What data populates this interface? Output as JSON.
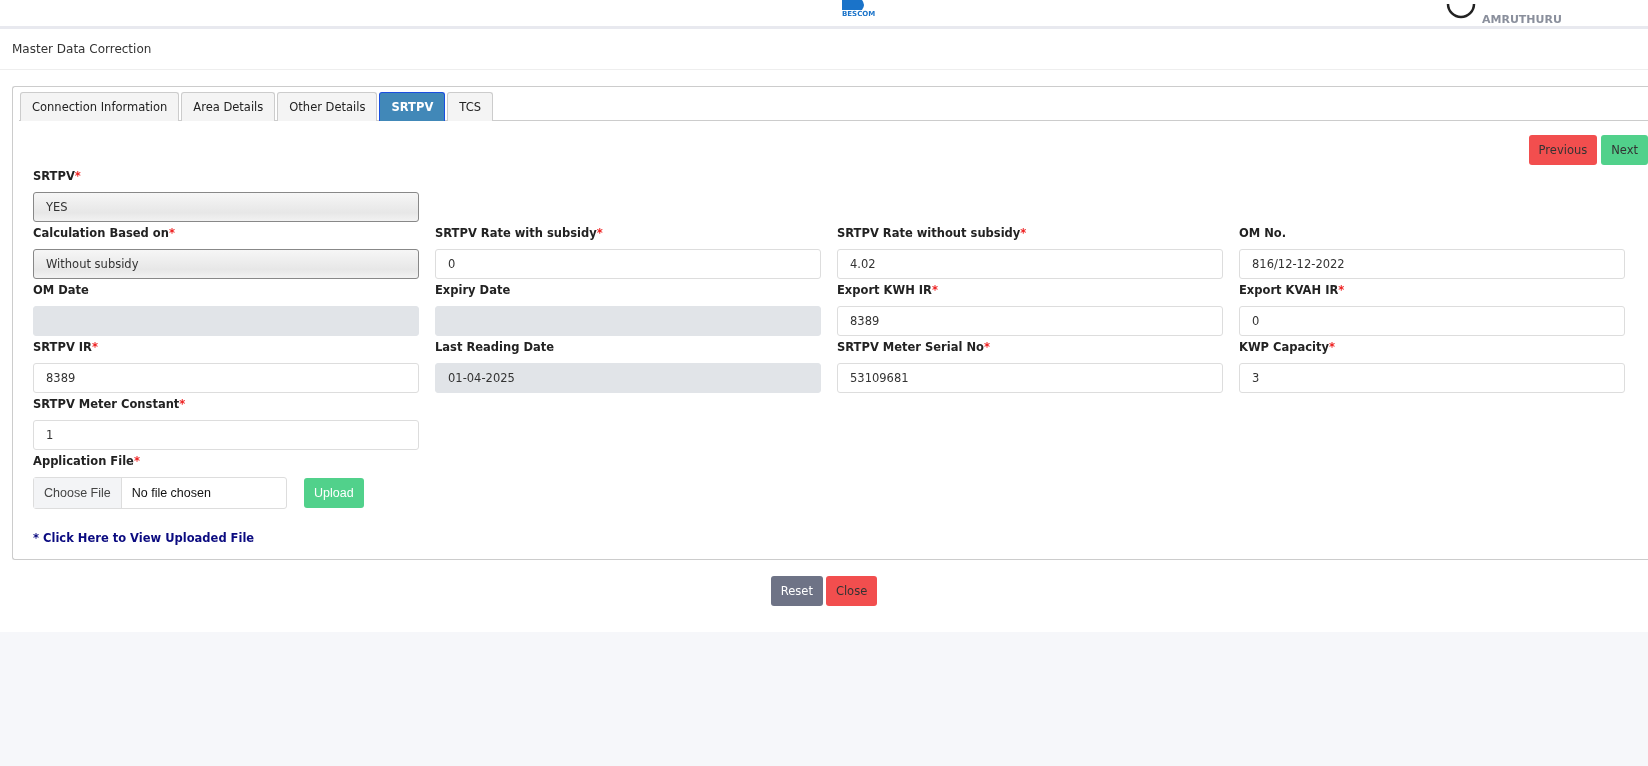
{
  "header": {
    "logo_text": "BESCOM",
    "user_name": "AMRUTHURU"
  },
  "page_title": "Master Data Correction",
  "tabs": [
    {
      "label": "Connection Information",
      "selected": false
    },
    {
      "label": "Area Details",
      "selected": false
    },
    {
      "label": "Other Details",
      "selected": false
    },
    {
      "label": "SRTPV",
      "selected": true
    },
    {
      "label": "TCS",
      "selected": false
    }
  ],
  "nav_buttons": [
    {
      "label": "Previous",
      "kind": "danger"
    },
    {
      "label": "Next",
      "kind": "success"
    }
  ],
  "rows": [
    [
      {
        "label": "SRTPV",
        "mark": "*",
        "kind": "select",
        "value": "YES"
      }
    ],
    [
      {
        "label": "Calculation Based on",
        "mark": "*",
        "kind": "select",
        "value": "Without subsidy"
      },
      {
        "label": "SRTPV Rate with subsidy",
        "mark": "*",
        "kind": "input",
        "value": "0"
      },
      {
        "label": "SRTPV Rate without subsidy",
        "mark": "*",
        "kind": "input",
        "value": "4.02"
      },
      {
        "label": "OM No.",
        "kind": "input",
        "value": "816/12-12-2022"
      }
    ],
    [
      {
        "label": "OM Date",
        "kind": "disabled"
      },
      {
        "label": "Expiry Date",
        "kind": "disabled"
      },
      {
        "label": "Export KWH IR",
        "mark": "*",
        "kind": "input",
        "value": "8389"
      },
      {
        "label": "Export KVAH IR",
        "mark": "*",
        "kind": "input",
        "value": "0"
      }
    ],
    [
      {
        "label": "SRTPV IR",
        "mark": "*",
        "kind": "input",
        "value": "8389"
      },
      {
        "label": "Last Reading Date",
        "kind": "disabled",
        "value": "01-04-2025"
      },
      {
        "label": "SRTPV Meter Serial No",
        "mark": "*",
        "kind": "input",
        "value": "53109681"
      },
      {
        "label": "KWP Capacity",
        "mark": "*",
        "kind": "input",
        "value": "3"
      }
    ],
    [
      {
        "label": "SRTPV Meter Constant",
        "mark": "*",
        "kind": "input",
        "value": "1"
      }
    ]
  ],
  "file": {
    "label": "Application File",
    "mark": "*",
    "button": "Choose File",
    "status": "No file chosen",
    "upload": "Upload"
  },
  "view_link": "* Click Here to View Uploaded File",
  "footer_buttons": [
    {
      "label": "Reset",
      "kind": "secondary"
    },
    {
      "label": "Close",
      "kind": "danger"
    }
  ]
}
